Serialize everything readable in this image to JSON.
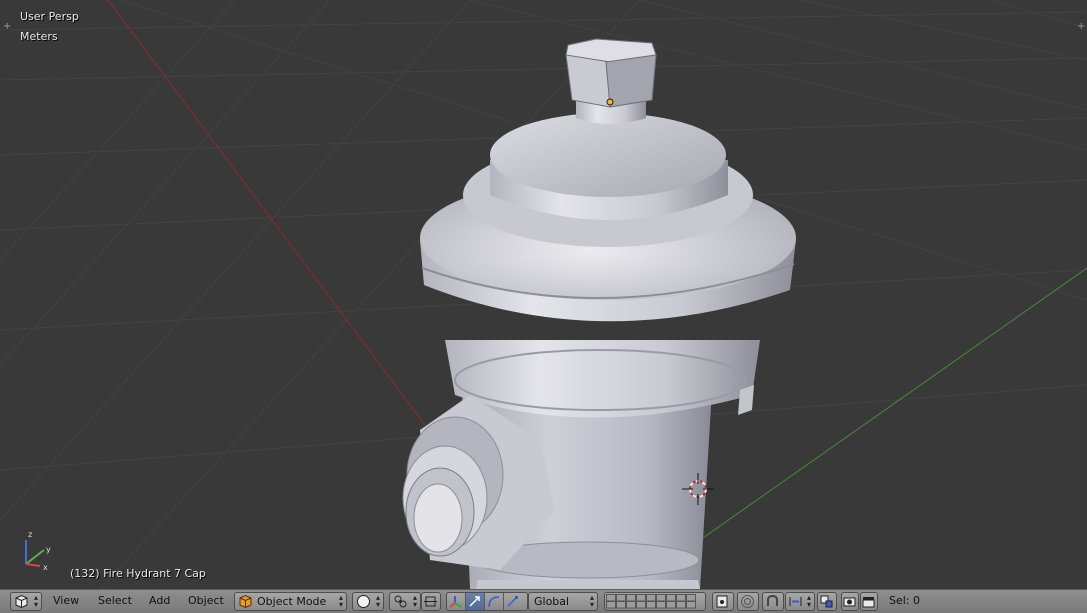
{
  "viewport": {
    "view_label": "User Persp",
    "units_label": "Meters",
    "object_info": "(132) Fire Hydrant 7 Cap",
    "axis": {
      "z": "z",
      "y": "y",
      "x": "x"
    },
    "corner_plus": "+"
  },
  "header": {
    "menus": [
      "View",
      "Select",
      "Add",
      "Object"
    ],
    "mode": "Object Mode",
    "orientation": "Global",
    "selection": "Sel: 0"
  },
  "colors": {
    "background": "#393939",
    "grid": "#424242",
    "x_axis": "#8c2b2b",
    "y_axis": "#4a8a3a",
    "header": "#808080",
    "accent": "#5a73a5"
  }
}
